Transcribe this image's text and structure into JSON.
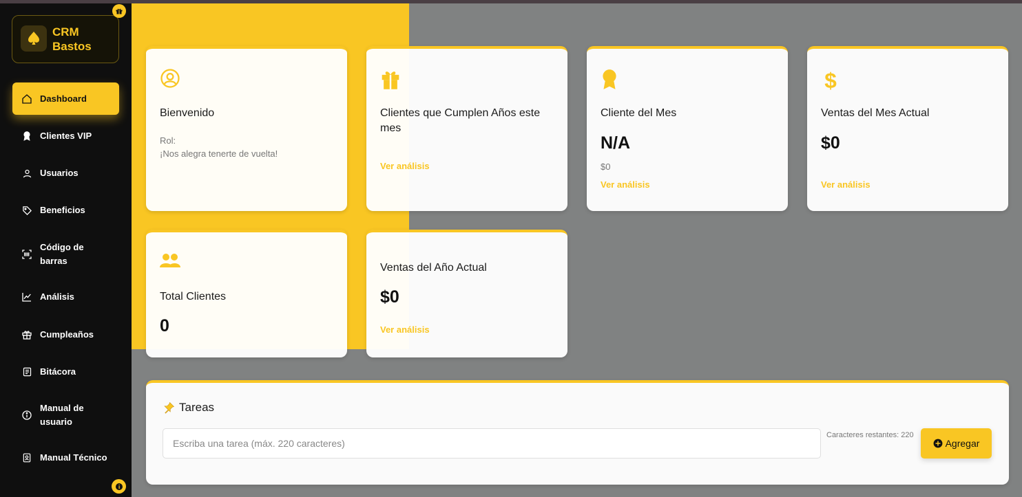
{
  "brand": {
    "line1": "CRM",
    "line2": "Bastos"
  },
  "nav": [
    {
      "label": "Dashboard",
      "icon": "home-icon",
      "active": true
    },
    {
      "label": "Clientes VIP",
      "icon": "award-icon"
    },
    {
      "label": "Usuarios",
      "icon": "user-icon"
    },
    {
      "label": "Beneficios",
      "icon": "tag-icon"
    },
    {
      "label": "Código de barras",
      "icon": "barcode-icon"
    },
    {
      "label": "Análisis",
      "icon": "chart-line-icon"
    },
    {
      "label": "Cumpleaños",
      "icon": "gift-icon"
    },
    {
      "label": "Bitácora",
      "icon": "journal-icon"
    },
    {
      "label": "Manual de usuario",
      "icon": "info-icon"
    },
    {
      "label": "Manual Técnico",
      "icon": "id-badge-icon"
    }
  ],
  "cards": {
    "welcome": {
      "title": "Bienvenido",
      "role": "Rol:",
      "message": "¡Nos alegra tenerte de vuelta!",
      "icon": "user-circle-icon"
    },
    "birthdays": {
      "title": "Clientes que Cumplen Años este mes",
      "link": "Ver análisis",
      "icon": "gift-icon"
    },
    "client_month": {
      "title": "Cliente del Mes",
      "value": "N/A",
      "amount": "$0",
      "link": "Ver análisis",
      "icon": "award-icon"
    },
    "sales_month": {
      "title": "Ventas del Mes Actual",
      "value": "$0",
      "link": "Ver análisis",
      "icon": "dollar-icon"
    },
    "total_clients": {
      "title": "Total Clientes",
      "value": "0",
      "icon": "users-icon"
    },
    "sales_year": {
      "title": "Ventas del Año Actual",
      "value": "$0",
      "link": "Ver análisis"
    }
  },
  "tasks": {
    "title": "Tareas",
    "placeholder": "Escriba una tarea (máx. 220 caracteres)",
    "remaining": "Caracteres restantes: 220",
    "add_label": "Agregar"
  },
  "colors": {
    "accent": "#f9c623",
    "sidebar": "#0f0f0f",
    "overlay": "#808282"
  }
}
